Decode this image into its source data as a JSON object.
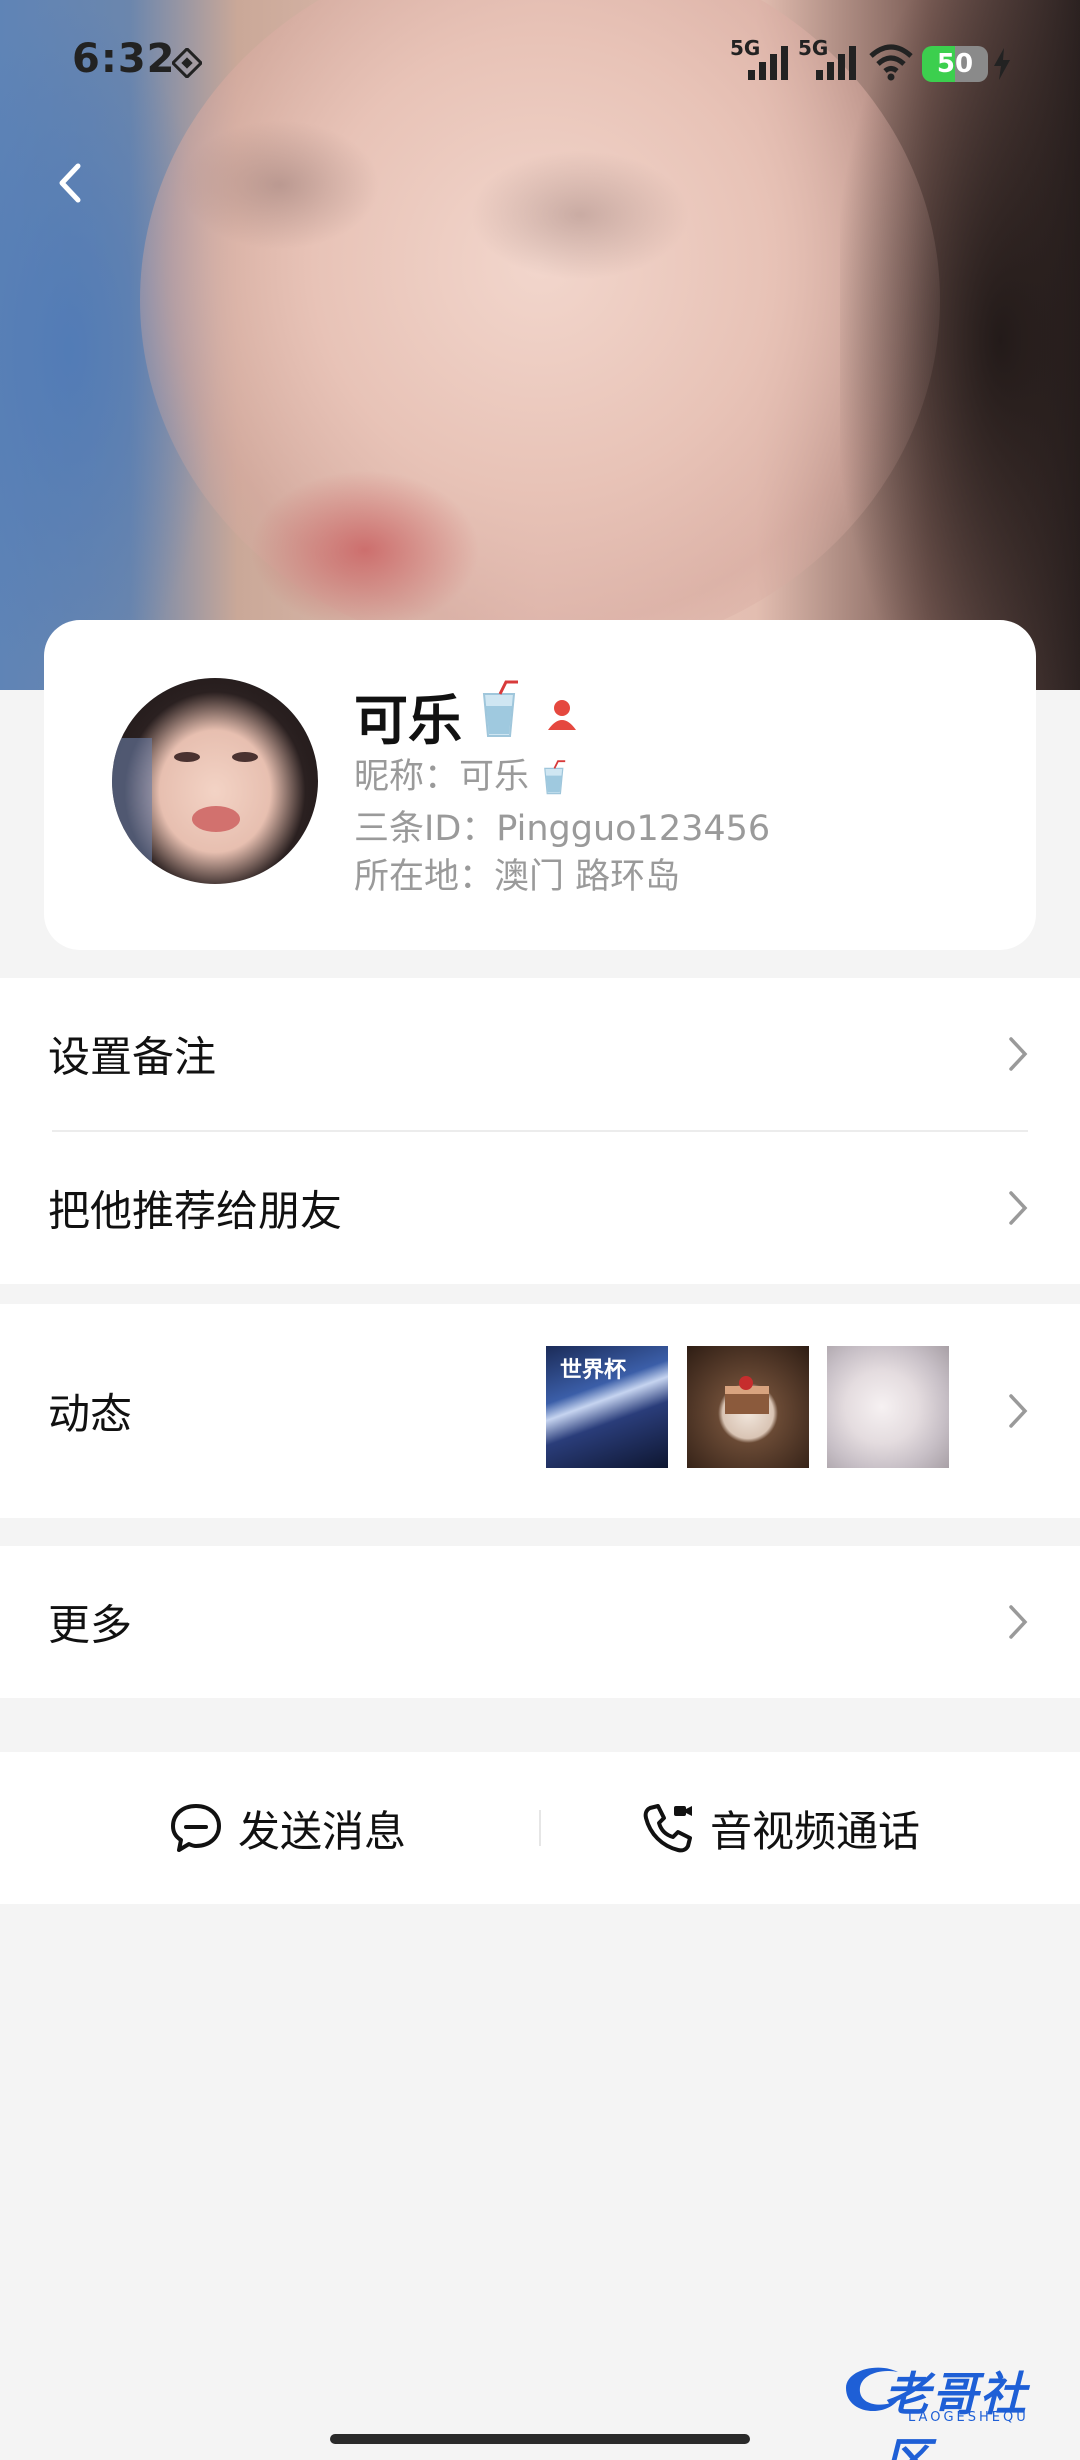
{
  "status_bar": {
    "time": "6:32",
    "network1": "5G",
    "network2": "5G",
    "battery": "50"
  },
  "profile": {
    "name": "可乐",
    "nickname": "昵称：可乐",
    "id": "三条ID：Pingguo123456",
    "location": "所在地：澳门 路环岛"
  },
  "menu": {
    "remark": "设置备注",
    "recommend": "把他推荐给朋友",
    "moments": "动态",
    "more": "更多"
  },
  "moments_thumbs": [
    "世界杯"
  ],
  "actions": {
    "send_message": "发送消息",
    "av_call": "音视频通话"
  },
  "watermark": {
    "title": "老哥社区",
    "subtitle": "LAOGESHEQU"
  },
  "colors": {
    "background": "#f4f4f4",
    "card": "#ffffff",
    "secondary_text": "#9a9a9a",
    "battery_green": "#3ccf4e",
    "badge_red": "#e5483f",
    "watermark_blue": "#1e5fd6"
  }
}
